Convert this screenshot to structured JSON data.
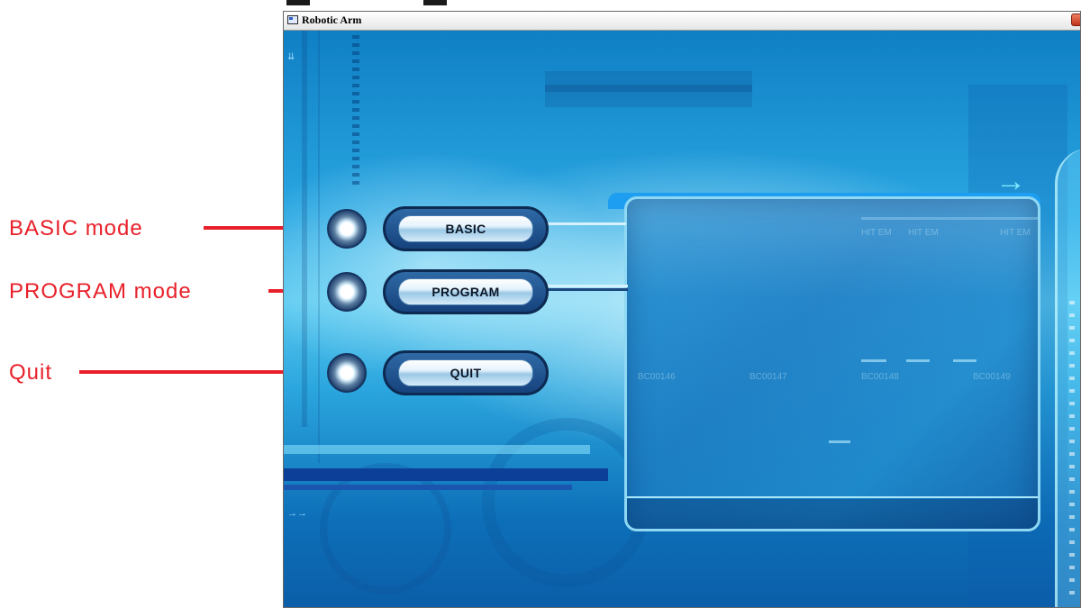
{
  "annotations": [
    {
      "key": "basic",
      "text": "BASIC  mode"
    },
    {
      "key": "program",
      "text": "PROGRAM  mode"
    },
    {
      "key": "quit",
      "text": "Quit"
    }
  ],
  "window": {
    "title": "Robotic Arm",
    "close_icon": "close-icon"
  },
  "menu": {
    "basic_label": "BASIC",
    "program_label": "PROGRAM",
    "quit_label": "QUIT"
  },
  "screen_text": {
    "code1": "BC00146",
    "code2": "BC00147",
    "code3": "BC00148",
    "code4": "BC00149",
    "hdr1": "HIT EM",
    "hdr2": "HIT EM",
    "hdr3": "HIT EM"
  },
  "colors": {
    "annotation": "#e8202a",
    "background_blue": "#1a8fd0"
  }
}
